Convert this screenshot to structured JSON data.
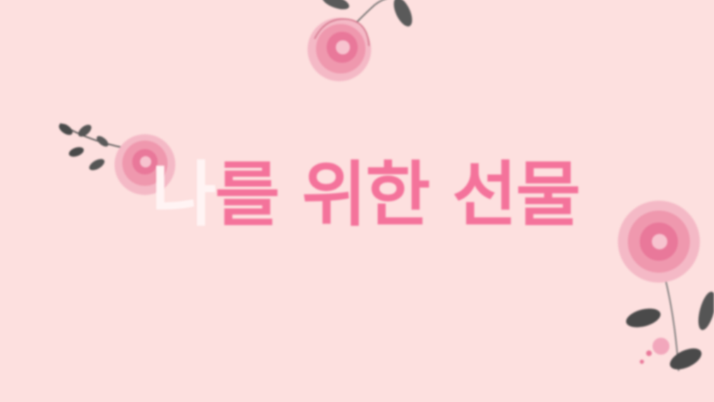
{
  "slide": {
    "title_first_char": "나",
    "title_rest": "를 위한 선물"
  },
  "colors": {
    "background": "#fde0df",
    "title_accent": "#f4739b",
    "title_highlight": "#fff4f4",
    "rose": "#f08aa5",
    "leaf": "#4a4a4a"
  },
  "decorations": [
    "rose-flower-top",
    "rose-flower-left",
    "rose-flower-right"
  ]
}
